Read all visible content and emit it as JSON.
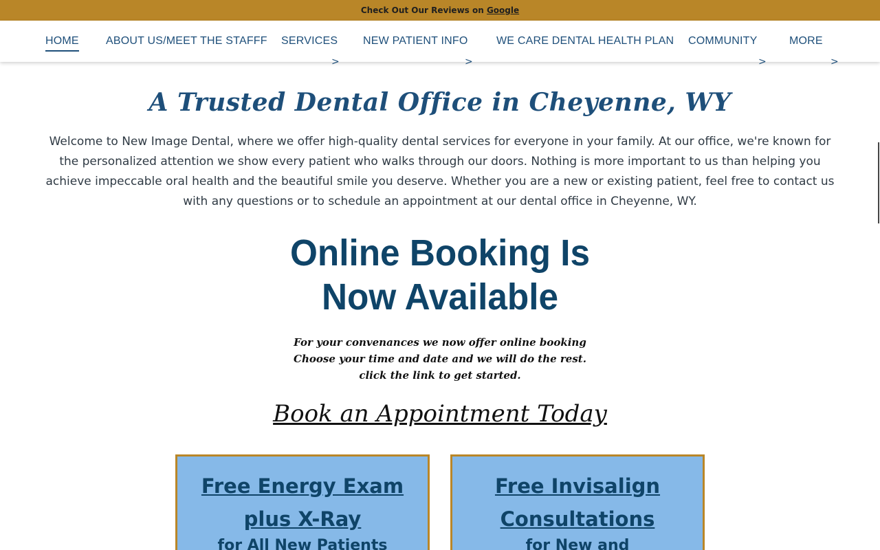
{
  "topbar": {
    "prefix": "Check Out Our Reviews on ",
    "link": "Google"
  },
  "nav": {
    "items": [
      {
        "label": "HOME",
        "active": true,
        "has_submenu": false
      },
      {
        "label": "ABOUT US/MEET THE STAFFF",
        "has_submenu": false
      },
      {
        "label": "SERVICES",
        "has_submenu": true
      },
      {
        "label": "NEW PATIENT INFO",
        "has_submenu": true
      },
      {
        "label": "WE CARE DENTAL HEALTH PLAN",
        "has_submenu": false
      },
      {
        "label": "COMMUNITY",
        "has_submenu": true
      },
      {
        "label": "MORE",
        "has_submenu": true
      }
    ],
    "caret": ">"
  },
  "hero": {
    "headline": "A Trusted Dental Office in Cheyenne, WY",
    "intro": "Welcome to New Image Dental, where we offer high-quality dental services for everyone in your family. At our office, we're known for the personalized attention we show every patient who walks through our doors. Nothing is more important to us than helping you achieve impeccable oral health and the beautiful smile you deserve. Whether you are a new or existing patient, feel free to contact us with any questions or to schedule an appointment at our dental office in Cheyenne, WY."
  },
  "booking": {
    "title_line1": "Online Booking Is",
    "title_line2": "Now Available",
    "sub_line1": "For your convenances we now offer online booking",
    "sub_line2": "Choose your time and date and we will do the rest.",
    "sub_line3": "click the link to get started.",
    "link": "Book an Appointment Today"
  },
  "cards": [
    {
      "title_line1": "Free Energy Exam",
      "title_line2": "plus X-Ray",
      "sub": "for All New Patients"
    },
    {
      "title_line1": "Free Invisalign",
      "title_line2": "Consultations",
      "sub": "for New and"
    }
  ],
  "colors": {
    "accent_gold": "#b98628",
    "navy": "#0f4468",
    "nav_blue": "#1e4f7a",
    "card_blue": "#86b9e8"
  }
}
